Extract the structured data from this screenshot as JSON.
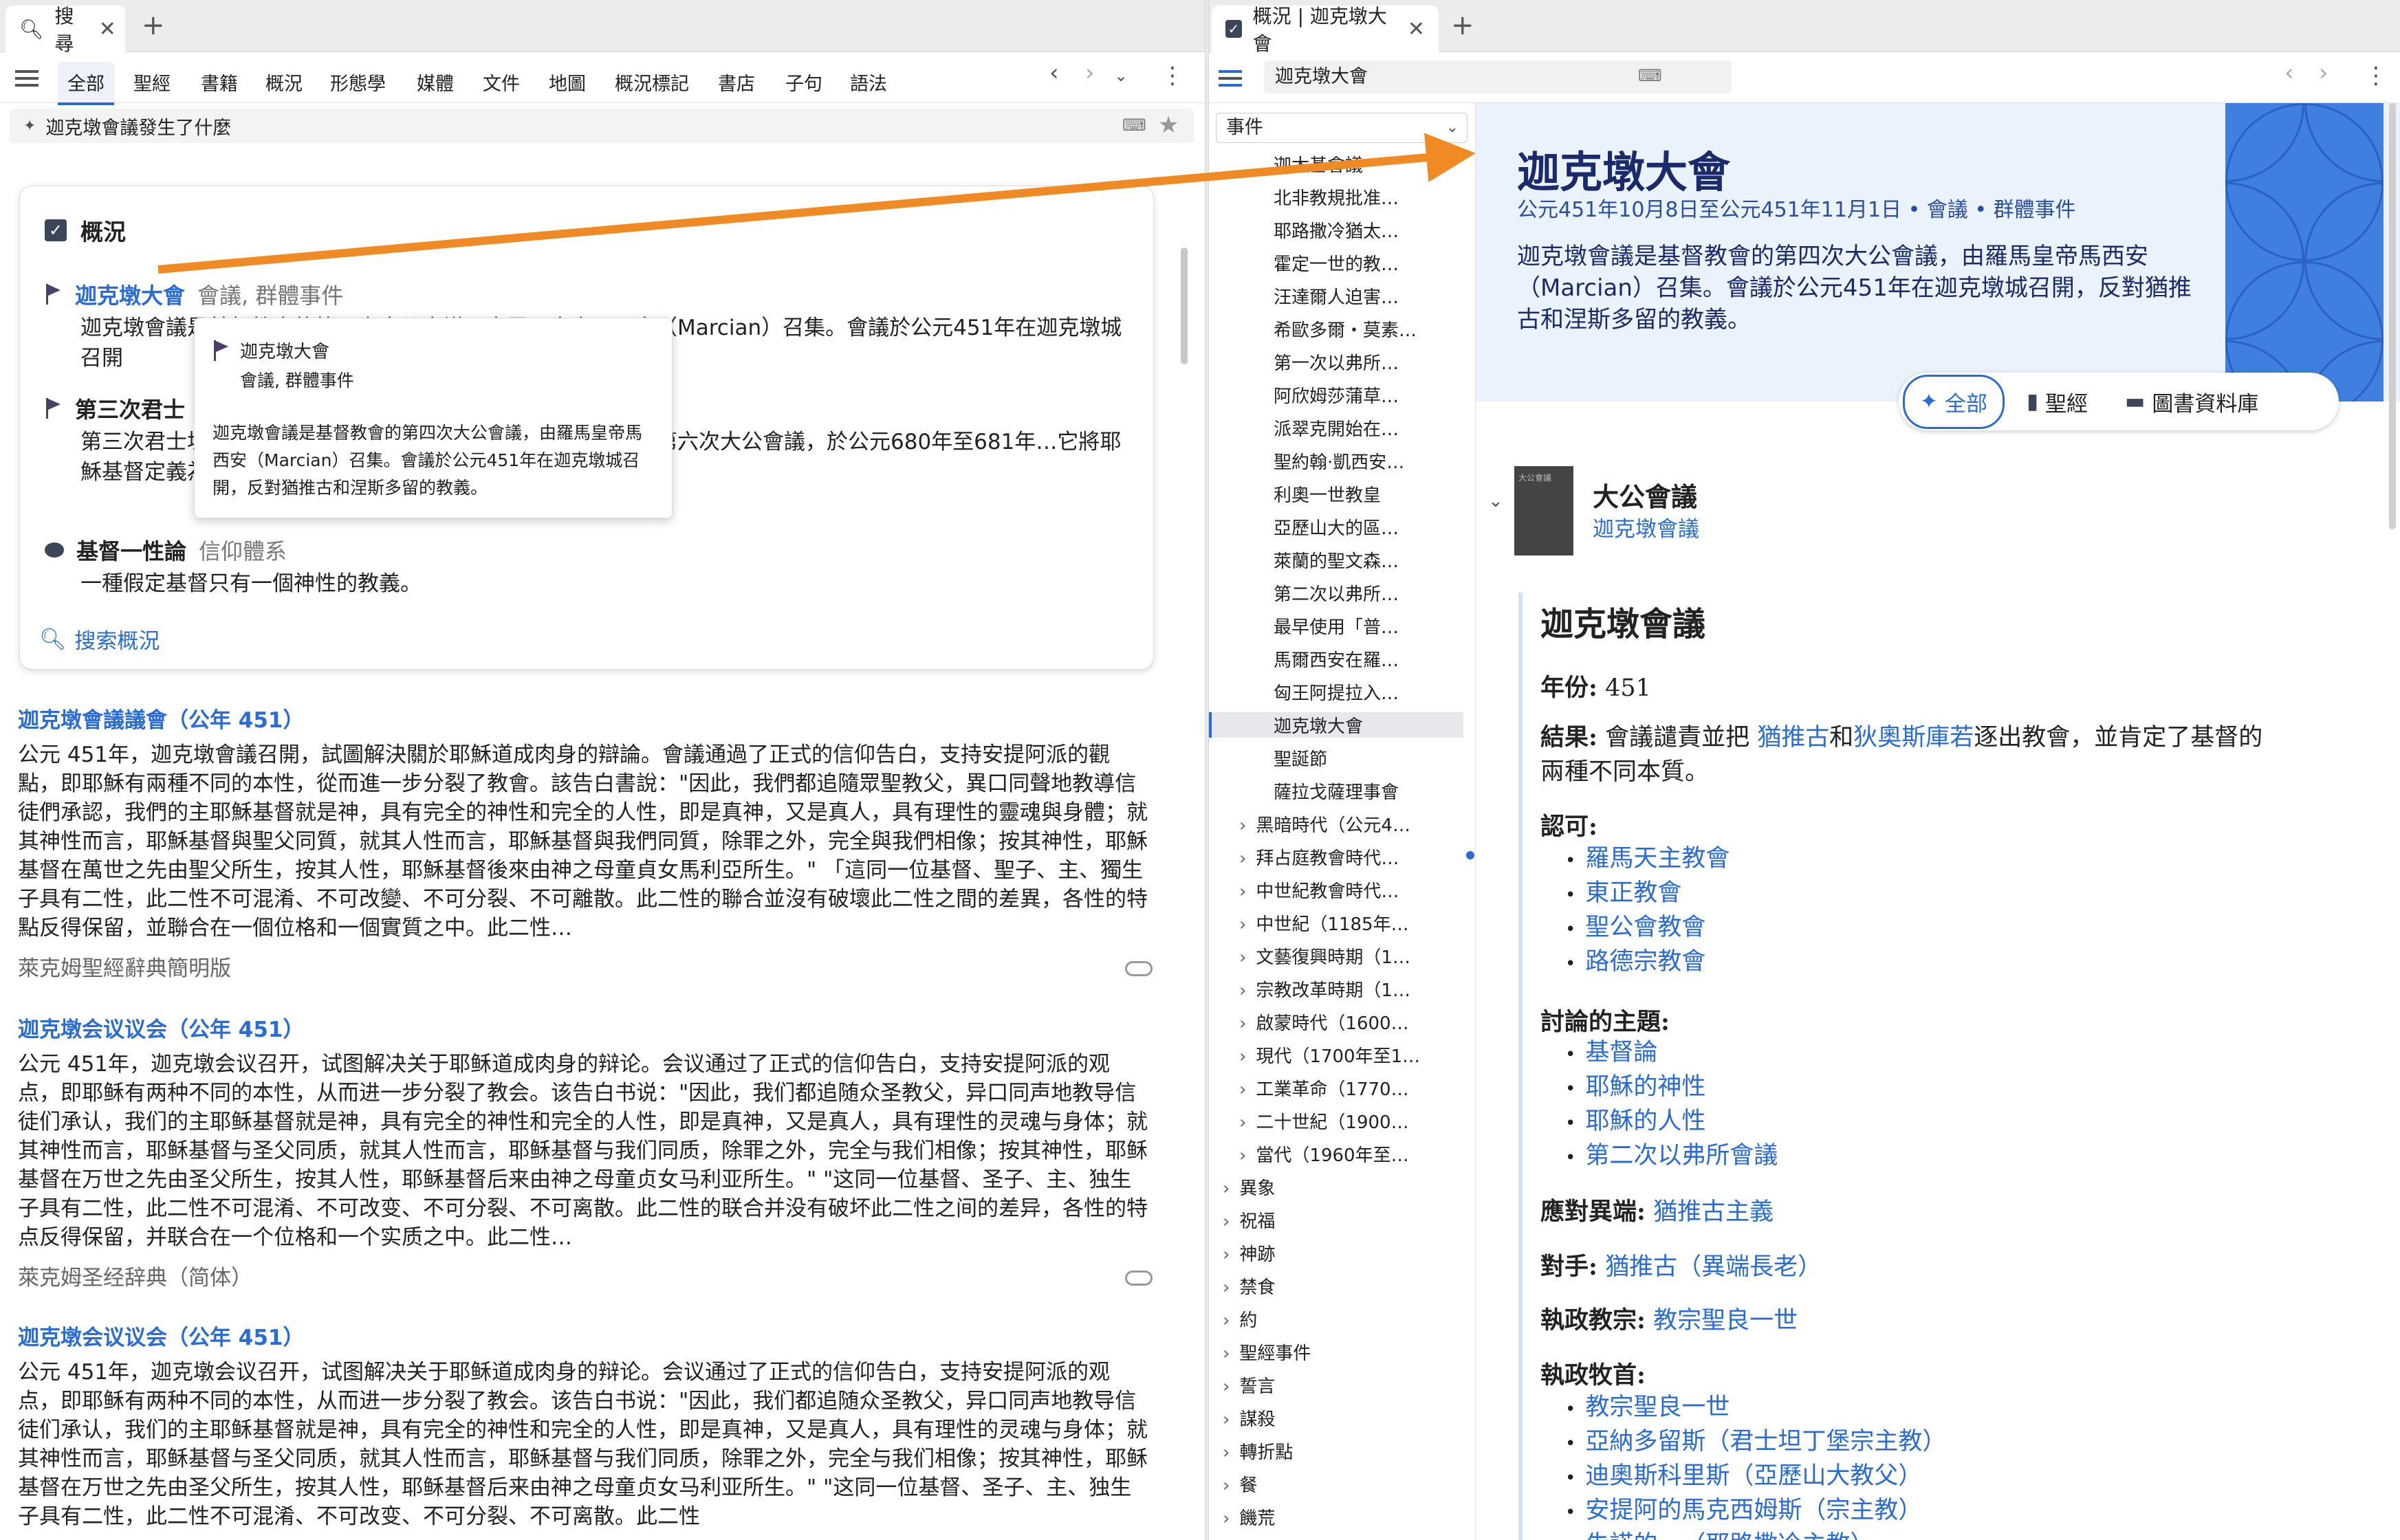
{
  "left": {
    "tab_title": "搜尋",
    "nav_tabs": [
      "全部",
      "聖經",
      "書籍",
      "概況",
      "形態學",
      "媒體",
      "文件",
      "地圖",
      "概況標記",
      "書店",
      "子句",
      "語法"
    ],
    "search_text": "迦克墩會議發生了什麼",
    "overview": {
      "title": "概況",
      "entries": [
        {
          "name": "迦克墩大會",
          "type": "會議, 群體事件",
          "desc": "迦克墩會議是基督教會的第四次大公會議，由羅馬皇帝馬西安（Marcian）召集。會議於公元451年在迦克墩城召開"
        },
        {
          "name": "第三次君士",
          "type": "",
          "desc": "第三次君士坦丁堡會議是第六次大公會議，其它西方教會視為第六次大公會議，於公元680年至681年…它將耶穌基督定義為擁有兩種能量和兩種意志（神的和人的）"
        },
        {
          "name": "基督一性論",
          "type": "信仰體系",
          "desc": "一種假定基督只有一個神性的教義。"
        }
      ],
      "search_overview": "搜索概況"
    },
    "tooltip": {
      "name": "迦克墩大會",
      "type": "會議, 群體事件",
      "desc": "迦克墩會議是基督教會的第四次大公會議，由羅馬皇帝馬西安（Marcian）召集。會議於公元451年在迦克墩城召開，反對猶推古和涅斯多留的教義。"
    },
    "results": [
      {
        "title": "迦克墩會議議會（公年 451）",
        "body": "公元 451年，迦克墩會議召開，試圖解決關於耶穌道成肉身的辯論。會議通過了正式的信仰告白，支持安提阿派的觀點，即耶穌有兩種不同的本性，從而進一步分裂了教會。該告白書說：\"因此，我們都追隨眾聖教父，異口同聲地教導信徒們承認，我們的主耶穌基督就是神，具有完全的神性和完全的人性，即是真神，又是真人，具有理性的靈魂與身體；就其神性而言，耶穌基督與聖父同質，就其人性而言，耶穌基督與我們同質，除罪之外，完全與我們相像；按其神性，耶穌基督在萬世之先由聖父所生，按其人性，耶穌基督後來由神之母童貞女馬利亞所生。\" 「這同一位基督、聖子、主、獨生子具有二性，此二性不可混淆、不可改變、不可分裂、不可離散。此二性的聯合並沒有破壞此二性之間的差異，各性的特點反得保留，並聯合在一個位格和一個實質之中。此二性…",
        "source": "萊克姆聖經辭典簡明版"
      },
      {
        "title": "迦克墩会议议会（公年 451）",
        "body": "公元 451年，迦克墩会议召开，试图解决关于耶稣道成肉身的辩论。会议通过了正式的信仰告白，支持安提阿派的观点，即耶稣有两种不同的本性，从而进一步分裂了教会。该告白书说：\"因此，我们都追随众圣教父，异口同声地教导信徒们承认，我们的主耶稣基督就是神，具有完全的神性和完全的人性，即是真神，又是真人，具有理性的灵魂与身体；就其神性而言，耶稣基督与圣父同质，就其人性而言，耶稣基督与我们同质，除罪之外，完全与我们相像；按其神性，耶稣基督在万世之先由圣父所生，按其人性，耶稣基督后来由神之母童贞女马利亚所生。\" \"这同一位基督、圣子、主、独生子具有二性，此二性不可混淆、不可改变、不可分裂、不可离散。此二性的联合并没有破坏此二性之间的差异，各性的特点反得保留，并联合在一个位格和一个实质之中。此二性…",
        "source": "萊克姆圣经辞典（简体）"
      },
      {
        "title": "迦克墩会议议会（公年 451）",
        "body": "公元 451年，迦克墩会议召开，试图解决关于耶稣道成肉身的辩论。会议通过了正式的信仰告白，支持安提阿派的观点，即耶稣有两种不同的本性，从而进一步分裂了教会。该告白书说：\"因此，我们都追随众圣教父，异口同声地教导信徒们承认，我们的主耶稣基督就是神，具有完全的神性和完全的人性，即是真神，又是真人，具有理性的灵魂与身体；就其神性而言，耶稣基督与圣父同质，就其人性而言，耶稣基督与我们同质，除罪之外，完全与我们相像；按其神性，耶稣基督在万世之先由圣父所生，按其人性，耶稣基督后来由神之母童贞女马利亚所生。\" \"这同一位基督、圣子、主、独生子具有二性，此二性不可混淆、不可改变、不可分裂、不可离散。此二性",
        "source": ""
      }
    ]
  },
  "right": {
    "tab_title": "概況 | 迦克墩大會",
    "search_text": "迦克墩大會",
    "tree_select": "事件",
    "tree_items": [
      "迦太基會議",
      "北非教規批准…",
      "耶路撒冷猶太…",
      "霍定一世的教…",
      "汪達爾人迫害…",
      "希歐多爾・莫素…",
      "第一次以弗所…",
      "阿欣姆莎蒲草…",
      "派翠克開始在…",
      "聖約翰·凱西安…",
      "利奧一世教皇",
      "亞歷山大的區…",
      "萊蘭的聖文森…",
      "第二次以弗所…",
      "最早使用「普…",
      "馬爾西安在羅…",
      "匈王阿提拉入…",
      "迦克墩大會",
      "聖誕節",
      "薩拉戈薩理事會"
    ],
    "tree_groups": [
      "黑暗時代（公元4…",
      "拜占庭教會時代…",
      "中世紀教會時代…",
      "中世紀（1185年…",
      "文藝復興時期（1…",
      "宗教改革時期（1…",
      "啟蒙時代（1600…",
      "現代（1700年至1…",
      "工業革命（1770…",
      "二十世紀（1900…",
      "當代（1960年至…"
    ],
    "tree_roots": [
      "異象",
      "祝福",
      "神跡",
      "禁食",
      "約",
      "聖經事件",
      "誓言",
      "謀殺",
      "轉折點",
      "餐",
      "饑荒"
    ],
    "hero": {
      "title": "迦克墩大會",
      "meta": "公元451年10月8日至公元451年11月1日 • 會議 • 群體事件",
      "desc": "迦克墩會議是基督教會的第四次大公會議，由羅馬皇帝馬西安（Marcian）召集。會議於公元451年在迦克墩城召開，反對猶推古和涅斯多留的教義。"
    },
    "segments": [
      "全部",
      "聖經",
      "圖書資料庫"
    ],
    "resource": {
      "book_thumb": "大公會議",
      "title": "大公會議",
      "subtitle": "迦克墩會議"
    },
    "article": {
      "title": "迦克墩會議",
      "year_label": "年份:",
      "year": "451",
      "result_label": "結果:",
      "result_1": "會議譴責並把",
      "result_link1": "猶推古",
      "result_and": "和",
      "result_link2": "狄奧斯庫若",
      "result_2": "逐出教會，並肯定了基督的",
      "result_3": "兩種不同本質。",
      "recog_label": "認可:",
      "recog": [
        "羅馬天主教會",
        "東正教會",
        "聖公會教會",
        "路德宗教會"
      ],
      "topics_label": "討論的主題:",
      "topics": [
        "基督論",
        "耶穌的神性",
        "耶穌的人性",
        "第二次以弗所會議"
      ],
      "heresy_label": "應對異端:",
      "heresy": "猶推古主義",
      "opp_label": "對手:",
      "opp": "猶推古（異端長老）",
      "pope_label": "執政教宗:",
      "pope": "教宗聖良一世",
      "pastors_label": "執政牧首:",
      "pastors": [
        "教宗聖良一世",
        "亞納多留斯（君士坦丁堡宗主教）",
        "迪奧斯科里斯（亞歷山大教父）",
        "安提阿的馬克西姆斯（宗主教）",
        "朱諾的…（耶路撒冷主教）"
      ]
    }
  },
  "colors": {
    "accent": "#2a6cd6",
    "arrow": "#f08a24",
    "hero_bg": "#eaf2fc",
    "pattern": "#3f7fe0"
  }
}
